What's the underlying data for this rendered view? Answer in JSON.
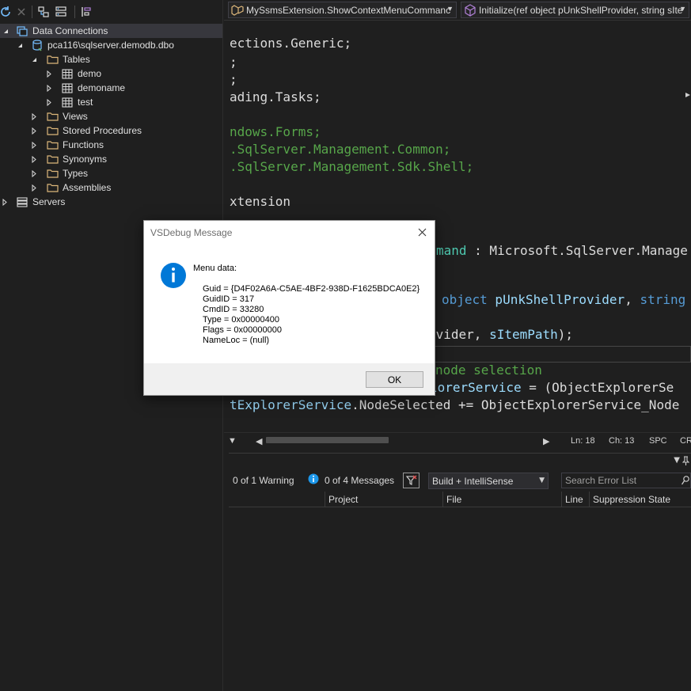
{
  "server_explorer": {
    "tree": [
      {
        "label": "Data Connections",
        "icon": "data-connections-icon",
        "arrow": "expanded",
        "selected": true
      },
      {
        "label": "pca116\\sqlserver.demodb.dbo",
        "icon": "database-connection-icon",
        "arrow": "expanded"
      },
      {
        "label": "Tables",
        "icon": "folder-icon",
        "arrow": "expanded"
      },
      {
        "label": "demo",
        "icon": "table-icon",
        "arrow": "collapsed"
      },
      {
        "label": "demoname",
        "icon": "table-icon",
        "arrow": "collapsed"
      },
      {
        "label": "test",
        "icon": "table-icon",
        "arrow": "collapsed"
      },
      {
        "label": "Views",
        "icon": "folder-icon",
        "arrow": "collapsed"
      },
      {
        "label": "Stored Procedures",
        "icon": "folder-icon",
        "arrow": "collapsed"
      },
      {
        "label": "Functions",
        "icon": "folder-icon",
        "arrow": "collapsed"
      },
      {
        "label": "Synonyms",
        "icon": "folder-icon",
        "arrow": "collapsed"
      },
      {
        "label": "Types",
        "icon": "folder-icon",
        "arrow": "collapsed"
      },
      {
        "label": "Assemblies",
        "icon": "folder-icon",
        "arrow": "collapsed"
      },
      {
        "label": "Servers",
        "icon": "servers-icon",
        "arrow": "collapsed"
      }
    ]
  },
  "editor": {
    "nav_left": "MySsmsExtension.ShowContextMenuCommanc",
    "nav_right": "Initialize(ref object pUnkShellProvider, string sIte",
    "lines": {
      "l1": "ections.Generic;",
      "l2": ";",
      "l3": ";",
      "l4": "ading.Tasks;",
      "l5": "ndows.Forms;",
      "l6": ".SqlServer.Management.Common;",
      "l7": ".SqlServer.Management.Sdk.Shell;",
      "l8": "xtension",
      "l9a": "mand",
      "l9b": " : Microsoft.SqlServer.Manage",
      "l10a": "object",
      "l10b": " pUnkShellProvider",
      "l10c": ", ",
      "l10d": "string",
      "l11a": "ovider",
      "l11b": ", ",
      "l11c": "sItemPath",
      "l11d": ");",
      "l12": "node selection",
      "l13a": "lorerService",
      "l13b": " = (ObjectExplorerSe",
      "l14a": "tExplorerService",
      "l14b": ".NodeSelected += ObjectExplorerService_Node"
    }
  },
  "status": {
    "line": "Ln: 18",
    "char": "Ch: 13",
    "spc": "SPC",
    "crlf": "CR"
  },
  "error_list": {
    "warnings": "0 of 1 Warning",
    "messages": "0 of 4 Messages",
    "scope": "Build + IntelliSense",
    "search_placeholder": "Search Error List",
    "columns": [
      "Project",
      "File",
      "Line",
      "Suppression State"
    ]
  },
  "dialog": {
    "title": "VSDebug Message",
    "heading": "Menu data:",
    "lines": [
      "Guid = {D4F02A6A-C5AE-4BF2-938D-F1625BDCA0E2}",
      "GuidID = 317",
      "CmdID = 33280",
      "Type = 0x00000400",
      "Flags = 0x00000000",
      "NameLoc = (null)"
    ],
    "ok": "OK"
  },
  "colors": {
    "background": "#1f1f1f",
    "comment_green": "#57a64a",
    "type_teal": "#4ec9b0",
    "keyword_blue": "#569cd6",
    "param_lightblue": "#9cdcfe",
    "info_blue": "#0078d7"
  }
}
